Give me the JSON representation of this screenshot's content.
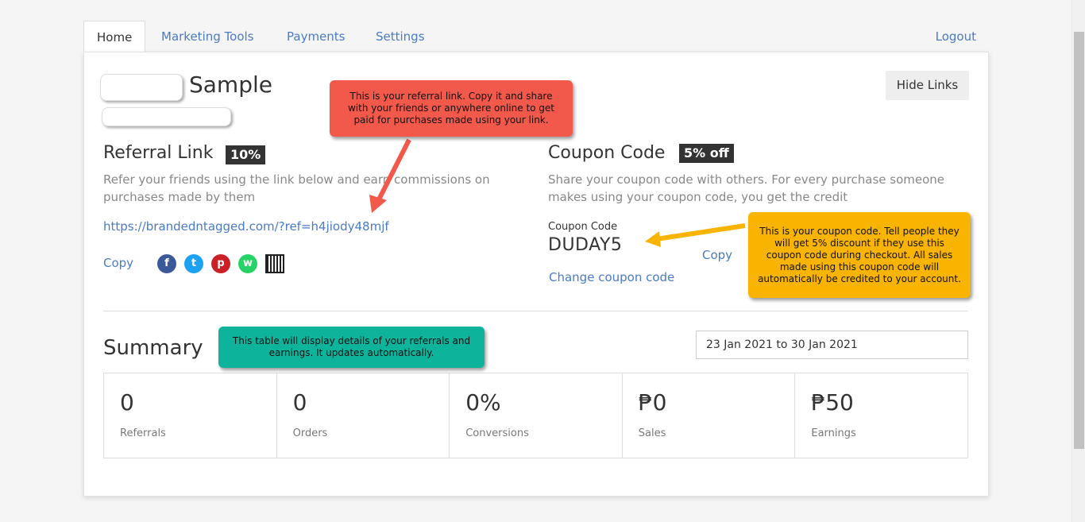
{
  "tabs": [
    "Home",
    "Marketing Tools",
    "Payments",
    "Settings"
  ],
  "logout_label": "Logout",
  "profile": {
    "name": "Sample"
  },
  "hide_links_label": "Hide Links",
  "referral": {
    "title": "Referral Link",
    "badge": "10%",
    "description": "Refer your friends using the link below and earn commissions on purchases made by them",
    "url": "https://brandedntagged.com/?ref=h4jiody48mjf",
    "copy_label": "Copy",
    "share_icons": [
      "facebook-icon",
      "twitter-icon",
      "pinterest-icon",
      "whatsapp-icon",
      "qr-code-icon"
    ]
  },
  "coupon": {
    "title": "Coupon Code",
    "badge": "5% off",
    "description": "Share your coupon code with others. For every purchase someone makes using your coupon code, you get the credit",
    "field_label": "Coupon Code",
    "code": "DUDAY5",
    "copy_label": "Copy",
    "change_label": "Change coupon code"
  },
  "summary": {
    "title": "Summary",
    "date_range": "23 Jan 2021 to 30 Jan 2021",
    "stats": [
      {
        "value": "0",
        "label": "Referrals"
      },
      {
        "value": "0",
        "label": "Orders"
      },
      {
        "value": "0%",
        "label": "Conversions"
      },
      {
        "value": "₱0",
        "label": "Sales"
      },
      {
        "value": "₱50",
        "label": "Earnings"
      }
    ]
  },
  "callouts": {
    "referral": "This is your referral link. Copy it and share with your friends or anywhere online to get paid for purchases made using your link.",
    "coupon": "This is your coupon code. Tell people they will get 5% discount if they use this coupon code during checkout. All sales made using this coupon code will automatically be credited to your account.",
    "summary": "This table will display details of your referrals and earnings. It updates automatically."
  },
  "colors": {
    "link": "#4a7bc4",
    "callout_red": "#f2594b",
    "callout_yellow": "#f8b400",
    "callout_teal": "#0eb39b",
    "badge": "#333333"
  }
}
